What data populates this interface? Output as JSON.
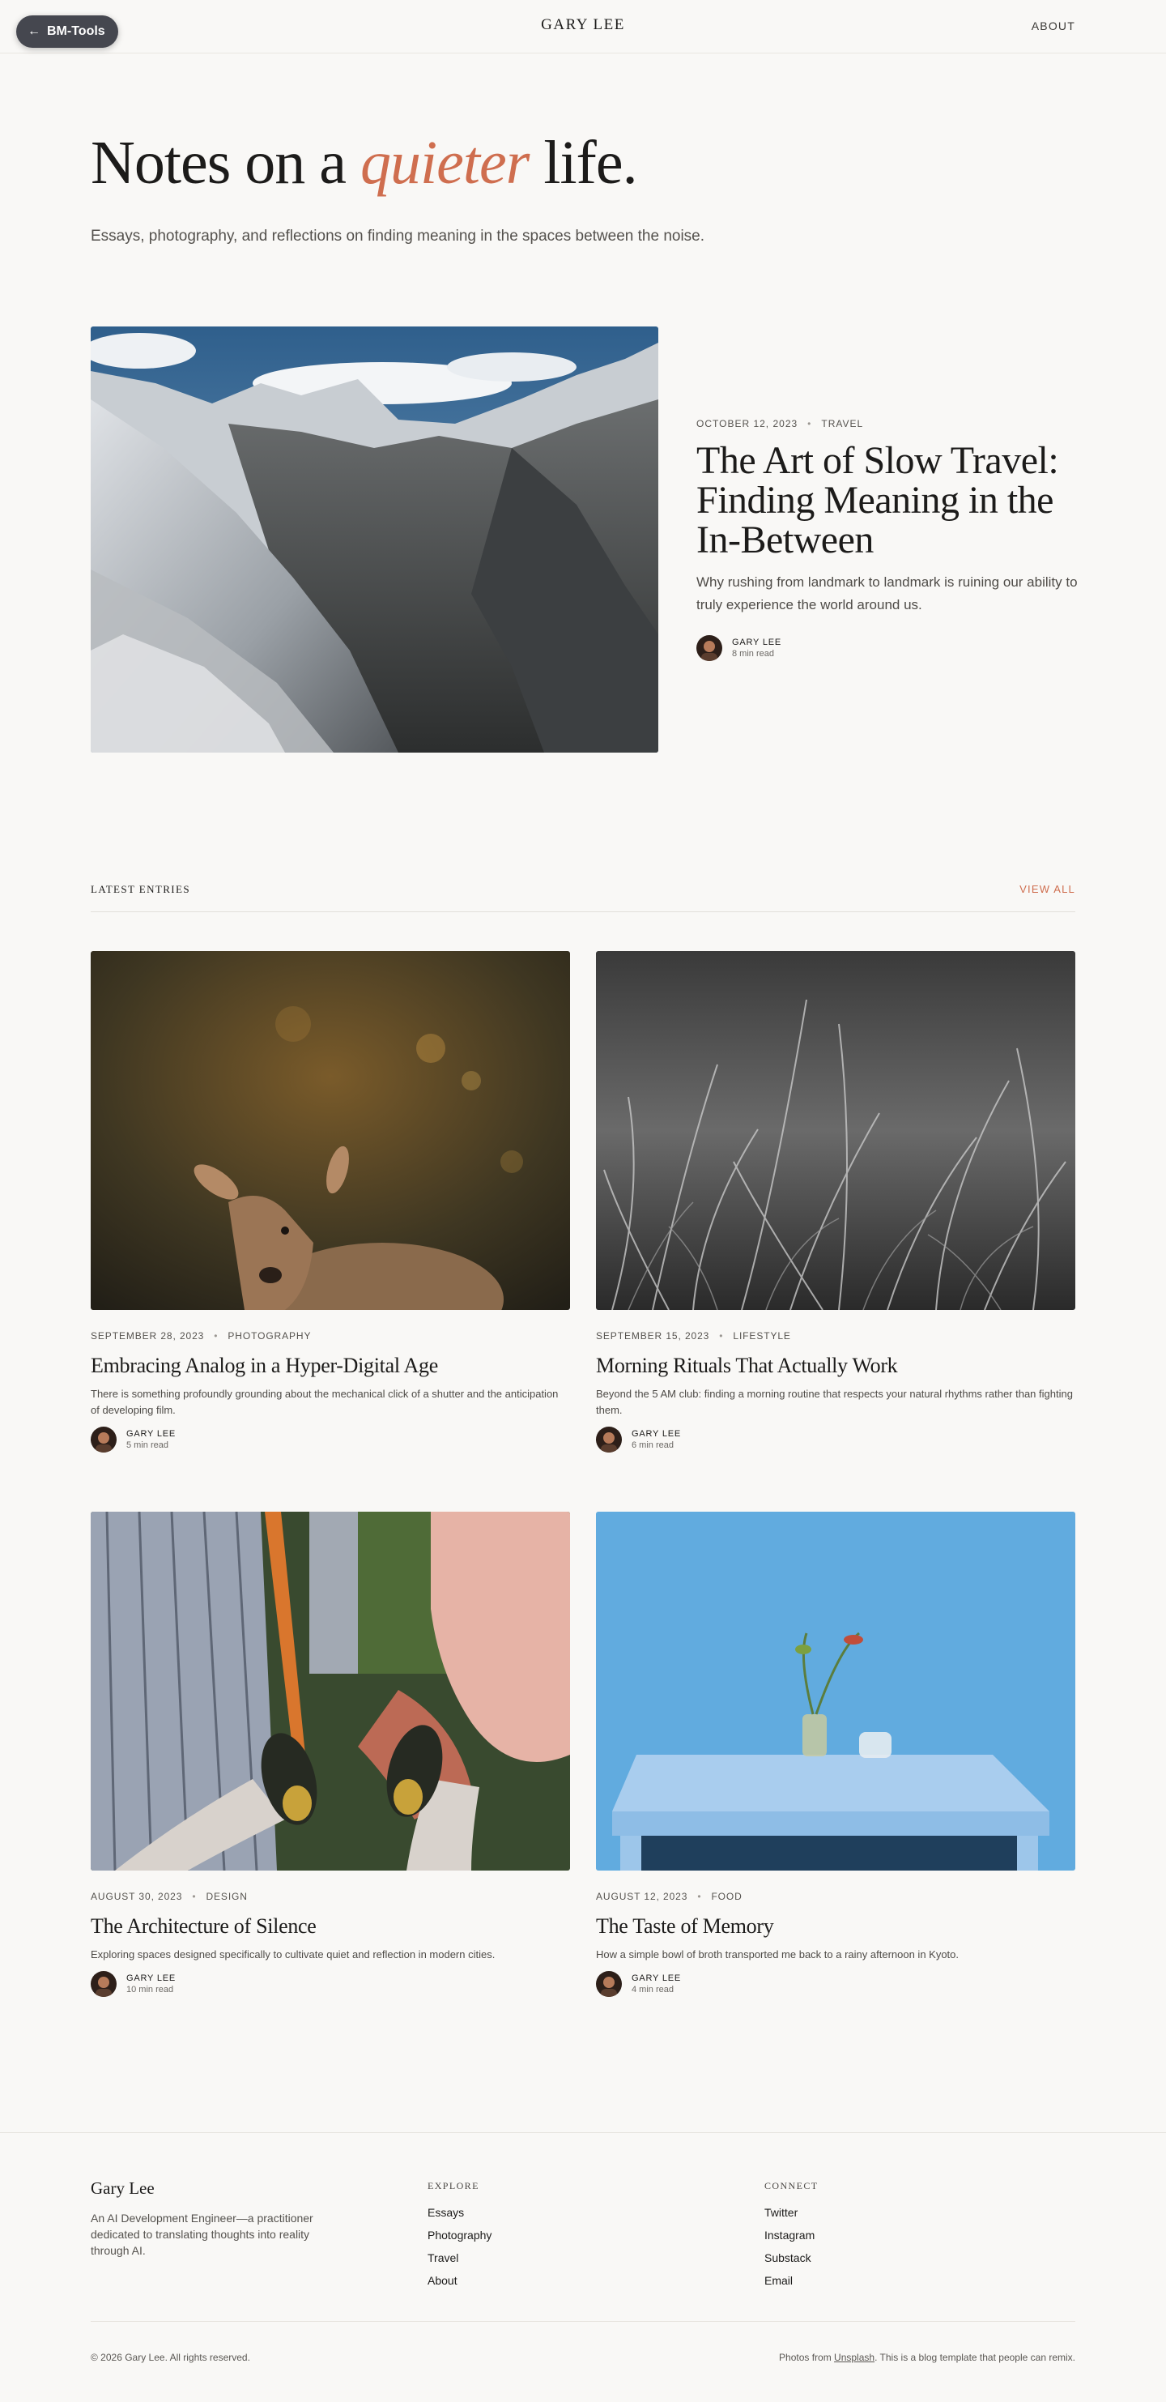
{
  "toolbar": {
    "back_label": "BM-Tools",
    "ghost_nav": "S"
  },
  "header": {
    "brand": "GARY LEE",
    "about": "ABOUT"
  },
  "hero": {
    "title_before": "Notes on a ",
    "title_em": "quieter",
    "title_after": " life.",
    "subtitle": "Essays, photography, and reflections on finding meaning in the spaces between the noise."
  },
  "featured": {
    "date": "OCTOBER 12, 2023",
    "category": "TRAVEL",
    "title": "The Art of Slow Travel: Finding Meaning in the In-Between",
    "excerpt": "Why rushing from landmark to landmark is ruining our ability to truly experience the world around us.",
    "author": "GARY LEE",
    "read_time": "8 min read"
  },
  "latest": {
    "label": "LATEST ENTRIES",
    "view_all": "VIEW ALL",
    "posts": [
      {
        "date": "SEPTEMBER 28, 2023",
        "category": "PHOTOGRAPHY",
        "title": "Embracing Analog in a Hyper-Digital Age",
        "excerpt": "There is something profoundly grounding about the mechanical click of a shutter and the anticipation of developing film.",
        "author": "GARY LEE",
        "read_time": "5 min read"
      },
      {
        "date": "SEPTEMBER 15, 2023",
        "category": "LIFESTYLE",
        "title": "Morning Rituals That Actually Work",
        "excerpt": "Beyond the 5 AM club: finding a morning routine that respects your natural rhythms rather than fighting them.",
        "author": "GARY LEE",
        "read_time": "6 min read"
      },
      {
        "date": "AUGUST 30, 2023",
        "category": "DESIGN",
        "title": "The Architecture of Silence",
        "excerpt": "Exploring spaces designed specifically to cultivate quiet and reflection in modern cities.",
        "author": "GARY LEE",
        "read_time": "10 min read"
      },
      {
        "date": "AUGUST 12, 2023",
        "category": "FOOD",
        "title": "The Taste of Memory",
        "excerpt": "How a simple bowl of broth transported me back to a rainy afternoon in Kyoto.",
        "author": "GARY LEE",
        "read_time": "4 min read"
      }
    ]
  },
  "footer": {
    "brand": "Gary Lee",
    "description": "An AI Development Engineer—a practitioner dedicated to translating thoughts into reality through AI.",
    "explore": {
      "heading": "EXPLORE",
      "links": [
        "Essays",
        "Photography",
        "Travel",
        "About"
      ]
    },
    "connect": {
      "heading": "CONNECT",
      "links": [
        "Twitter",
        "Instagram",
        "Substack",
        "Email"
      ]
    },
    "copyright": "© 2026 Gary Lee. All rights reserved.",
    "credit_before": "Photos from ",
    "credit_link": "Unsplash",
    "credit_after": ". This is a blog template that people can remix."
  },
  "colors": {
    "accent": "#cf6e4f",
    "background": "#f9f8f6",
    "text": "#1c1b1a",
    "pill": "#45474f"
  }
}
